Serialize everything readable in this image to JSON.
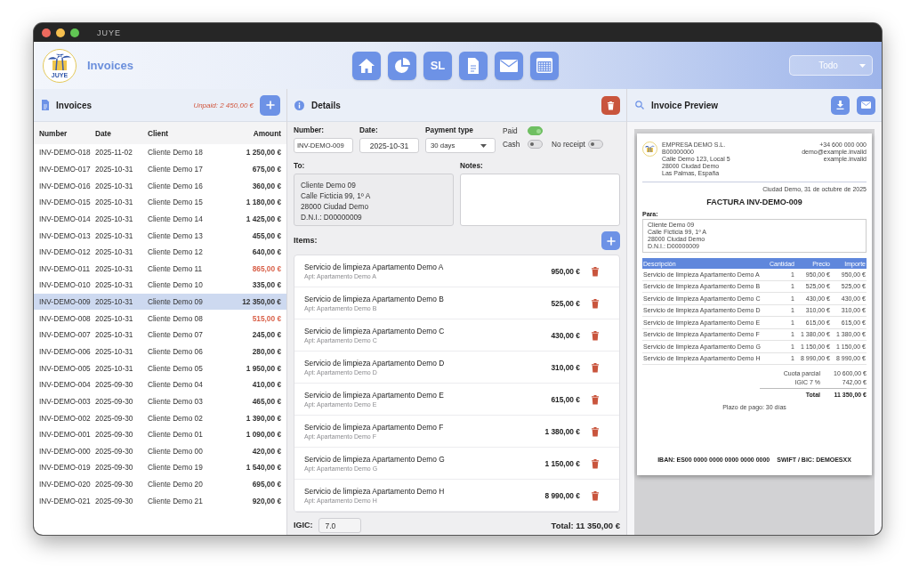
{
  "window": {
    "title": "JUYE"
  },
  "header": {
    "logo_text": "JUYE",
    "title": "Invoices",
    "nav_text_button": "SL",
    "filter": "Todo"
  },
  "invoices": {
    "title": "Invoices",
    "unpaid_total": "Unpaid: 2 450,00 €",
    "columns": [
      "Number",
      "Date",
      "Client",
      "Amount"
    ],
    "rows": [
      {
        "number": "INV-DEMO-018",
        "date": "2025-11-02",
        "client": "Cliente Demo 18",
        "amount": "1 250,00 €",
        "unpaid": false,
        "selected": false
      },
      {
        "number": "INV-DEMO-017",
        "date": "2025-10-31",
        "client": "Cliente Demo 17",
        "amount": "675,00 €",
        "unpaid": false,
        "selected": false
      },
      {
        "number": "INV-DEMO-016",
        "date": "2025-10-31",
        "client": "Cliente Demo 16",
        "amount": "360,00 €",
        "unpaid": false,
        "selected": false
      },
      {
        "number": "INV-DEMO-015",
        "date": "2025-10-31",
        "client": "Cliente Demo 15",
        "amount": "1 180,00 €",
        "unpaid": false,
        "selected": false
      },
      {
        "number": "INV-DEMO-014",
        "date": "2025-10-31",
        "client": "Cliente Demo 14",
        "amount": "1 425,00 €",
        "unpaid": false,
        "selected": false
      },
      {
        "number": "INV-DEMO-013",
        "date": "2025-10-31",
        "client": "Cliente Demo 13",
        "amount": "455,00 €",
        "unpaid": false,
        "selected": false
      },
      {
        "number": "INV-DEMO-012",
        "date": "2025-10-31",
        "client": "Cliente Demo 12",
        "amount": "640,00 €",
        "unpaid": false,
        "selected": false
      },
      {
        "number": "INV-DEMO-011",
        "date": "2025-10-31",
        "client": "Cliente Demo 11",
        "amount": "865,00 €",
        "unpaid": true,
        "selected": false
      },
      {
        "number": "INV-DEMO-010",
        "date": "2025-10-31",
        "client": "Cliente Demo 10",
        "amount": "335,00 €",
        "unpaid": false,
        "selected": false
      },
      {
        "number": "INV-DEMO-009",
        "date": "2025-10-31",
        "client": "Cliente Demo 09",
        "amount": "12 350,00 €",
        "unpaid": false,
        "selected": true
      },
      {
        "number": "INV-DEMO-008",
        "date": "2025-10-31",
        "client": "Cliente Demo 08",
        "amount": "515,00 €",
        "unpaid": true,
        "selected": false
      },
      {
        "number": "INV-DEMO-007",
        "date": "2025-10-31",
        "client": "Cliente Demo 07",
        "amount": "245,00 €",
        "unpaid": false,
        "selected": false
      },
      {
        "number": "INV-DEMO-006",
        "date": "2025-10-31",
        "client": "Cliente Demo 06",
        "amount": "280,00 €",
        "unpaid": false,
        "selected": false
      },
      {
        "number": "INV-DEMO-005",
        "date": "2025-10-31",
        "client": "Cliente Demo 05",
        "amount": "1 950,00 €",
        "unpaid": false,
        "selected": false
      },
      {
        "number": "INV-DEMO-004",
        "date": "2025-09-30",
        "client": "Cliente Demo 04",
        "amount": "410,00 €",
        "unpaid": false,
        "selected": false
      },
      {
        "number": "INV-DEMO-003",
        "date": "2025-09-30",
        "client": "Cliente Demo 03",
        "amount": "465,00 €",
        "unpaid": false,
        "selected": false
      },
      {
        "number": "INV-DEMO-002",
        "date": "2025-09-30",
        "client": "Cliente Demo 02",
        "amount": "1 390,00 €",
        "unpaid": false,
        "selected": false
      },
      {
        "number": "INV-DEMO-001",
        "date": "2025-09-30",
        "client": "Cliente Demo 01",
        "amount": "1 090,00 €",
        "unpaid": false,
        "selected": false
      },
      {
        "number": "INV-DEMO-000",
        "date": "2025-09-30",
        "client": "Cliente Demo 00",
        "amount": "420,00 €",
        "unpaid": false,
        "selected": false
      },
      {
        "number": "INV-DEMO-019",
        "date": "2025-09-30",
        "client": "Cliente Demo 19",
        "amount": "1 540,00 €",
        "unpaid": false,
        "selected": false
      },
      {
        "number": "INV-DEMO-020",
        "date": "2025-09-30",
        "client": "Cliente Demo 20",
        "amount": "695,00 €",
        "unpaid": false,
        "selected": false
      },
      {
        "number": "INV-DEMO-021",
        "date": "2025-09-30",
        "client": "Cliente Demo 21",
        "amount": "920,00 €",
        "unpaid": false,
        "selected": false
      }
    ]
  },
  "details": {
    "title": "Details",
    "number_label": "Number:",
    "number": "INV-DEMO-009",
    "date_label": "Date:",
    "date": "2025-10-31",
    "payment_label": "Payment type",
    "payment": "30 days",
    "toggles": [
      {
        "label": "Paid",
        "on": true
      },
      {
        "label": "Cash",
        "on": false
      },
      {
        "label": "No receipt",
        "on": false
      }
    ],
    "to_label": "To:",
    "to_lines": [
      "Cliente Demo 09",
      "Calle Ficticia 99, 1º A",
      "28000 Ciudad Demo",
      "D.N.I.: D00000009"
    ],
    "notes_label": "Notes:",
    "items_label": "Items:",
    "items": [
      {
        "title": "Servicio de limpieza Apartamento Demo A",
        "apartment": "Apt: Apartamento Demo A",
        "amount": "950,00 €"
      },
      {
        "title": "Servicio de limpieza Apartamento Demo B",
        "apartment": "Apt: Apartamento Demo B",
        "amount": "525,00 €"
      },
      {
        "title": "Servicio de limpieza Apartamento Demo C",
        "apartment": "Apt: Apartamento Demo C",
        "amount": "430,00 €"
      },
      {
        "title": "Servicio de limpieza Apartamento Demo D",
        "apartment": "Apt: Apartamento Demo D",
        "amount": "310,00 €"
      },
      {
        "title": "Servicio de limpieza Apartamento Demo E",
        "apartment": "Apt: Apartamento Demo E",
        "amount": "615,00 €"
      },
      {
        "title": "Servicio de limpieza Apartamento Demo F",
        "apartment": "Apt: Apartamento Demo F",
        "amount": "1 380,00 €"
      },
      {
        "title": "Servicio de limpieza Apartamento Demo G",
        "apartment": "Apt: Apartamento Demo G",
        "amount": "1 150,00 €"
      },
      {
        "title": "Servicio de limpieza Apartamento Demo H",
        "apartment": "Apt: Apartamento Demo H",
        "amount": "8 990,00 €"
      }
    ],
    "igic_label": "IGIC:",
    "igic": "7.0",
    "total": "Total: 11 350,00 €"
  },
  "preview": {
    "title": "Invoice Preview",
    "company_lines": [
      "EMPRESA DEMO S.L.",
      "B00000000",
      "Calle Demo 123, Local 5",
      "28000 Ciudad Demo",
      "Las Palmas, España"
    ],
    "contact_lines": [
      "+34 600 000 000",
      "demo@example.invalid",
      "example.invalid"
    ],
    "place_date": "Ciudad Demo, 31 de octubre de 2025",
    "heading": "FACTURA INV-DEMO-009",
    "to_label": "Para:",
    "to_lines": [
      "Cliente Demo 09",
      "Calle Ficticia 99, 1º A",
      "28000 Ciudad Demo",
      "D.N.I.: D00000009"
    ],
    "columns": [
      "Descripción",
      "Cantidad",
      "Precio",
      "Importe"
    ],
    "rows": [
      [
        "Servicio de limpieza Apartamento Demo A",
        "1",
        "950,00 €",
        "950,00 €"
      ],
      [
        "Servicio de limpieza Apartamento Demo B",
        "1",
        "525,00 €",
        "525,00 €"
      ],
      [
        "Servicio de limpieza Apartamento Demo C",
        "1",
        "430,00 €",
        "430,00 €"
      ],
      [
        "Servicio de limpieza Apartamento Demo D",
        "1",
        "310,00 €",
        "310,00 €"
      ],
      [
        "Servicio de limpieza Apartamento Demo E",
        "1",
        "615,00 €",
        "615,00 €"
      ],
      [
        "Servicio de limpieza Apartamento Demo F",
        "1",
        "1 380,00 €",
        "1 380,00 €"
      ],
      [
        "Servicio de limpieza Apartamento Demo G",
        "1",
        "1 150,00 €",
        "1 150,00 €"
      ],
      [
        "Servicio de limpieza Apartamento Demo H",
        "1",
        "8 990,00 €",
        "8 990,00 €"
      ]
    ],
    "totals": [
      {
        "label": "Cuota parcial",
        "value": "10 600,00 €"
      },
      {
        "label": "IGIC 7 %",
        "value": "742,00 €"
      },
      {
        "label": "Total",
        "value": "11 350,00 €"
      }
    ],
    "payment_terms": "Plazo de pago: 30 días",
    "iban": "IBAN: ES00 0000 0000 0000 0000 0000",
    "swift": "SWIFT / BIC: DEMOESXX"
  }
}
